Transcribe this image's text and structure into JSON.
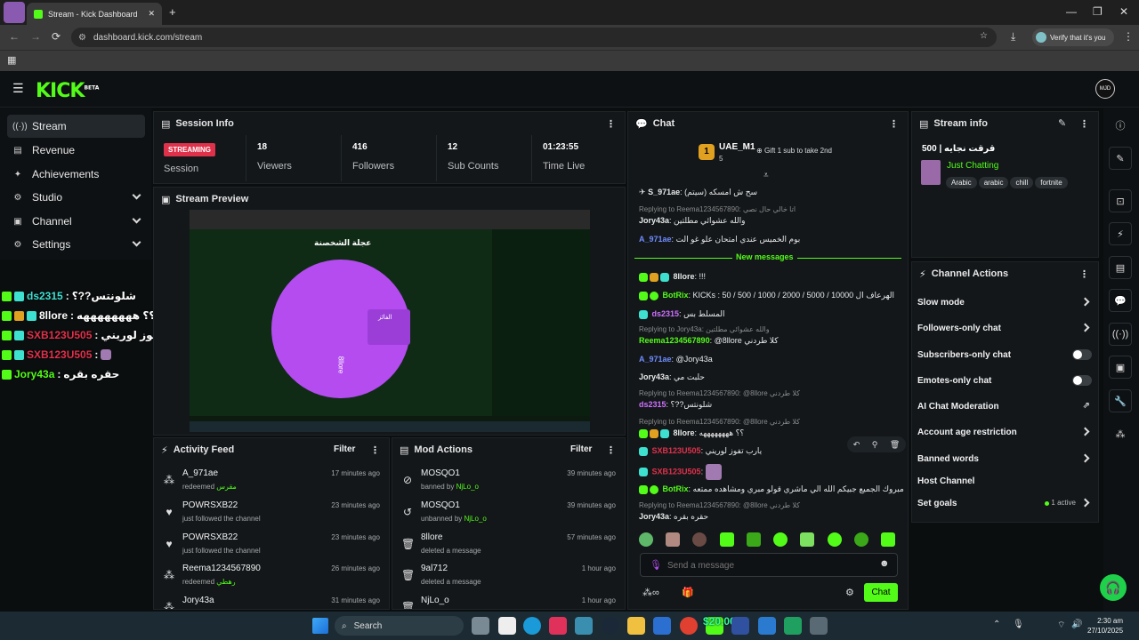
{
  "browser": {
    "tab_title": "Stream - Kick Dashboard",
    "url": "dashboard.kick.com/stream",
    "profile_label": "Verify that it's you"
  },
  "header": {
    "logo": "KICK",
    "logo_sup": "BETA",
    "avatar_initials": "MJD"
  },
  "sidebar": {
    "items": [
      {
        "label": "Stream",
        "icon": "broadcast-icon"
      },
      {
        "label": "Revenue",
        "icon": "revenue-icon"
      },
      {
        "label": "Achievements",
        "icon": "achievement-icon"
      },
      {
        "label": "Studio",
        "icon": "studio-icon"
      },
      {
        "label": "Channel",
        "icon": "channel-icon"
      },
      {
        "label": "Settings",
        "icon": "gear-icon"
      }
    ]
  },
  "overlay_chat": [
    {
      "name": "ds2315",
      "text": "شلونتس??؟",
      "color": "#3ee0d0"
    },
    {
      "name": "8llore",
      "text": "؟؟ ههههههههه",
      "color": "#ffffff"
    },
    {
      "name": "SXB123U505",
      "text": "يارب تفوز لوريني",
      "color": "#e0314b"
    },
    {
      "name": "SXB123U505",
      "text": "",
      "color": "#e0314b"
    },
    {
      "name": "Jory43a",
      "text": "حقره بقره",
      "color": "#53fc18"
    }
  ],
  "session": {
    "title": "Session Info",
    "status": "STREAMING",
    "status_label": "Session",
    "stats": [
      {
        "value": "18",
        "label": "Viewers"
      },
      {
        "value": "416",
        "label": "Followers"
      },
      {
        "value": "12",
        "label": "Sub Counts"
      },
      {
        "value": "01:23:55",
        "label": "Time Live"
      }
    ]
  },
  "preview": {
    "title": "Stream Preview",
    "wheel_title": "عجلة الشخصنة",
    "winner_label": "الفائز",
    "wheel_name": "8llore"
  },
  "activity": {
    "title": "Activity Feed",
    "filter": "Filter",
    "rows": [
      {
        "name": "A_971ae",
        "sub": "redeemed",
        "extra": "مقرس",
        "time": "17 minutes ago",
        "icon": "redeem-icon"
      },
      {
        "name": "POWRSXB22",
        "sub": "just followed the channel",
        "extra": "",
        "time": "23 minutes ago",
        "icon": "heart-icon"
      },
      {
        "name": "POWRSXB22",
        "sub": "just followed the channel",
        "extra": "",
        "time": "23 minutes ago",
        "icon": "heart-icon"
      },
      {
        "name": "Reema1234567890",
        "sub": "redeemed",
        "extra": "رهطي",
        "time": "26 minutes ago",
        "icon": "redeem-icon"
      },
      {
        "name": "Jory43a",
        "sub": "",
        "extra": "",
        "time": "31 minutes ago",
        "icon": "redeem-icon"
      }
    ]
  },
  "mod": {
    "title": "Mod Actions",
    "filter": "Filter",
    "rows": [
      {
        "name": "MOSQO1",
        "sub": "banned by",
        "extra": "NjLo_o",
        "time": "39 minutes ago",
        "icon": "ban-icon"
      },
      {
        "name": "MOSQO1",
        "sub": "unbanned by",
        "extra": "NjLo_o",
        "time": "39 minutes ago",
        "icon": "unban-icon"
      },
      {
        "name": "8llore",
        "sub": "deleted a message",
        "extra": "",
        "time": "57 minutes ago",
        "icon": "trash-icon"
      },
      {
        "name": "9al712",
        "sub": "deleted a message",
        "extra": "",
        "time": "1 hour ago",
        "icon": "trash-icon"
      },
      {
        "name": "NjLo_o",
        "sub": "",
        "extra": "",
        "time": "1 hour ago",
        "icon": "trash-icon"
      }
    ]
  },
  "chat": {
    "title": "Chat",
    "top_gifter": "UAE_M1",
    "top_gifter_count": "5",
    "gift_text": "Gift 1 sub to take 2nd",
    "new_messages": "New messages",
    "input_placeholder": "Send a message",
    "send_label": "Chat",
    "messages": [
      {
        "reply": "",
        "name": "S_971ae",
        "text": "سح ش امسكه (سيتم)",
        "color": "#e0e0e0"
      },
      {
        "reply": "Replying to Reema1234567890: اتا خالي حال نصي",
        "name": "Jory43a",
        "text": "والله عشوائي مطلتين",
        "color": "#e0e0e0"
      },
      {
        "reply": "",
        "name": "A_971ae",
        "text": "بوم الخميس عندي امتحان علو غو الت",
        "color": "#6f8cff"
      },
      {
        "reply": "",
        "name": "8llore",
        "text": "!!!",
        "color": "#ffffff"
      },
      {
        "reply": "",
        "name": "BotRix",
        "text": "KICKs : 50 / 500 / 1000 / 2000 / 5000 / 10000 الهرعاف ال",
        "color": "#53fc18"
      },
      {
        "reply": "",
        "name": "ds2315",
        "text": "المسلط بس",
        "color": "#d070ff"
      },
      {
        "reply": "Replying to Jory43a: والله عشوائي مطلتين",
        "name": "Reema1234567890",
        "text": "@8llore كلا طردني",
        "color": "#53fc18"
      },
      {
        "reply": "",
        "name": "A_971ae",
        "text": "@Jory43a",
        "color": "#6f8cff"
      },
      {
        "reply": "",
        "name": "Jory43a",
        "text": "حلبت مي",
        "color": "#e0e0e0"
      },
      {
        "reply": "Replying to Reema1234567890: @8llore كلا طردني",
        "name": "ds2315",
        "text": "شلونتس??؟",
        "color": "#d070ff"
      },
      {
        "reply": "Replying to Reema1234567890: @8llore كلا طردني",
        "name": "8llore",
        "text": "؟؟ ههههههههه",
        "color": "#ffffff"
      },
      {
        "reply": "",
        "name": "SXB123U505",
        "text": "يارب تفوز لوريني",
        "color": "#e0314b"
      },
      {
        "reply": "",
        "name": "SXB123U505",
        "text": "",
        "color": "#e0314b"
      },
      {
        "reply": "",
        "name": "BotRix",
        "text": "مبروك الجميع جبيكم الله الي ماشري قولو مبري ومشاهده ممتعه",
        "color": "#53fc18"
      },
      {
        "reply": "Replying to Reema1234567890: @8llore كلا طردني",
        "name": "Jory43a",
        "text": "حقره بقره",
        "color": "#e0e0e0"
      }
    ]
  },
  "stream_info": {
    "title": "Stream info",
    "stream_title": "500 | قرقت نجايه",
    "category": "Just Chatting",
    "tags": [
      "Arabic",
      "arabic",
      "chill",
      "fortnite"
    ]
  },
  "channel_actions": {
    "title": "Channel Actions",
    "items": [
      {
        "label": "Slow mode",
        "kind": "chevron"
      },
      {
        "label": "Followers-only chat",
        "kind": "chevron"
      },
      {
        "label": "Subscribers-only chat",
        "kind": "toggle"
      },
      {
        "label": "Emotes-only chat",
        "kind": "toggle"
      },
      {
        "label": "AI Chat Moderation",
        "kind": "external"
      },
      {
        "label": "Account age restriction",
        "kind": "chevron"
      },
      {
        "label": "Banned words",
        "kind": "chevron"
      },
      {
        "label": "Host Channel",
        "kind": "none"
      },
      {
        "label": "Set goals",
        "kind": "chevron",
        "extra": "1 active"
      }
    ]
  },
  "taskbar": {
    "search_label": "Search",
    "time": "2:30 am",
    "date": "27/10/2025",
    "ticker": "$20.00"
  },
  "colors": {
    "accent": "#53fc18",
    "streaming_badge": "#e0314b",
    "wheel": "#b44cf0"
  }
}
